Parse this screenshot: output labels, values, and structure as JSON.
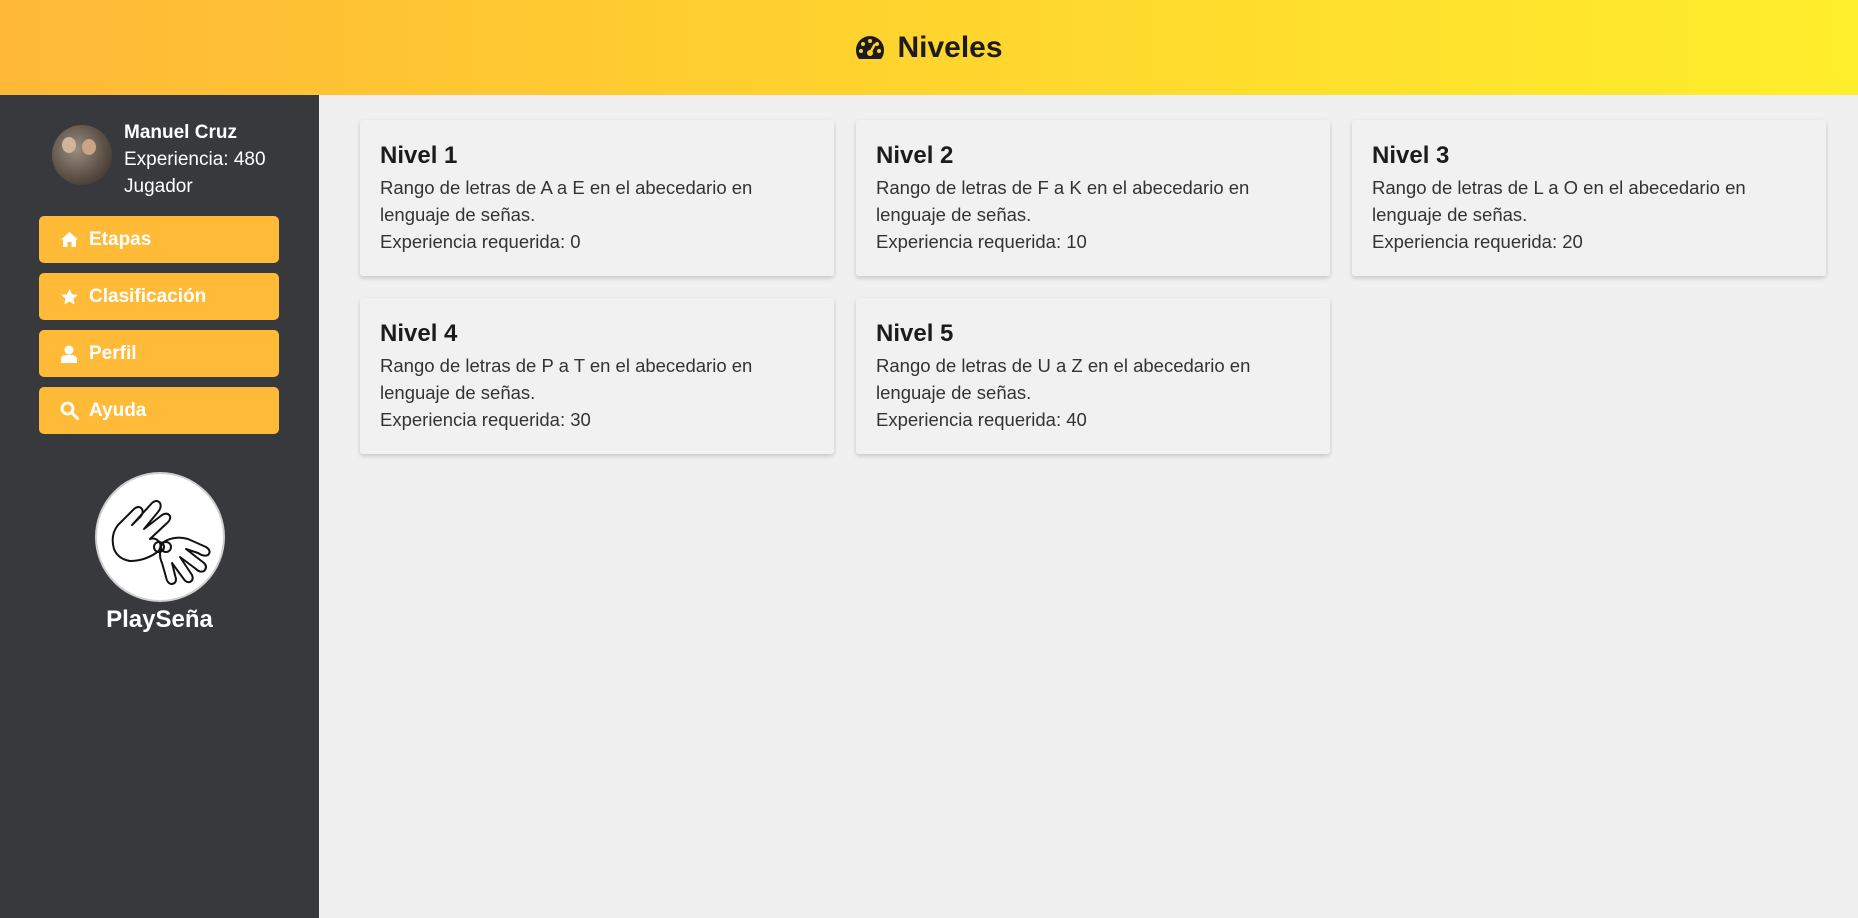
{
  "header": {
    "title": "Niveles",
    "icon": "gauge-icon"
  },
  "user": {
    "name": "Manuel Cruz",
    "experience": "Experiencia: 480",
    "role": "Jugador"
  },
  "nav": [
    {
      "label": "Etapas",
      "icon": "home-icon"
    },
    {
      "label": "Clasificación",
      "icon": "star-icon"
    },
    {
      "label": "Perfil",
      "icon": "user-icon"
    },
    {
      "label": "Ayuda",
      "icon": "search-icon"
    }
  ],
  "brand": {
    "name": "PlaySeña"
  },
  "levels": [
    {
      "title": "Nivel 1",
      "description": "Rango de letras de A a E en el abecedario en lenguaje de señas.",
      "requirement": "Experiencia requerida: 0"
    },
    {
      "title": "Nivel 2",
      "description": "Rango de letras de F a K en el abecedario en lenguaje de señas.",
      "requirement": "Experiencia requerida: 10"
    },
    {
      "title": "Nivel 3",
      "description": "Rango de letras de L a O en el abecedario en lenguaje de señas.",
      "requirement": "Experiencia requerida: 20"
    },
    {
      "title": "Nivel 4",
      "description": "Rango de letras de P a T en el abecedario en lenguaje de señas.",
      "requirement": "Experiencia requerida: 30"
    },
    {
      "title": "Nivel 5",
      "description": "Rango de letras de U a Z en el abecedario en lenguaje de señas.",
      "requirement": "Experiencia requerida: 40"
    }
  ],
  "colors": {
    "accent": "#ffbb38",
    "sidebar": "#37393d",
    "header_start": "#ffb838",
    "header_end": "#ffee2c"
  }
}
